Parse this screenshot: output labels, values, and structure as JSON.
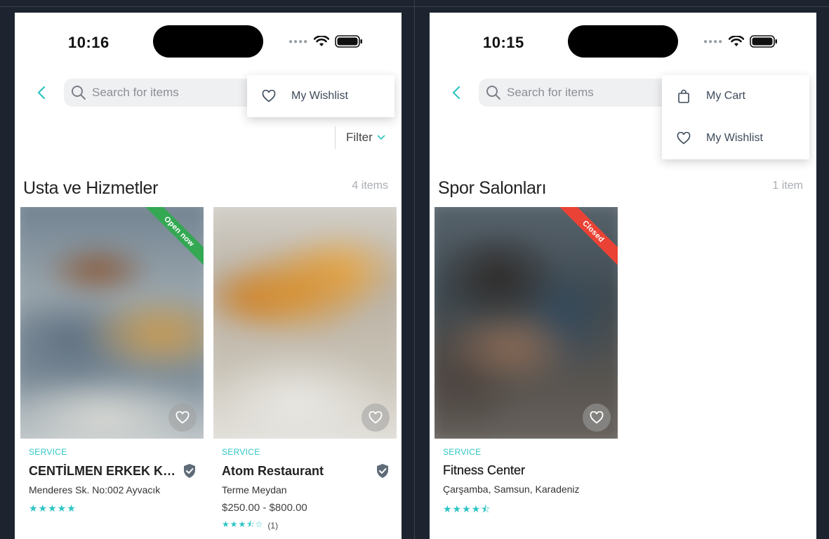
{
  "left_screen": {
    "status_time": "10:16",
    "search_placeholder": "Search for items",
    "filter_label": "Filter",
    "menu_items": [
      {
        "label": "My Wishlist",
        "icon": "heart-icon"
      }
    ],
    "section_title": "Usta ve Hizmetler",
    "section_count": "4 items",
    "cards": [
      {
        "category": "SERVICE",
        "title": "CENTİLMEN ERKEK KUAF...",
        "address": "Menderes Sk. No:002 Ayvacık",
        "price": "",
        "stars": "★★★★★",
        "rating_count": "",
        "ribbon": "Open now",
        "ribbon_color": "#34a853",
        "verified": true
      },
      {
        "category": "SERVICE",
        "title": "Atom Restaurant",
        "address": "Terme Meydan",
        "price": "$250.00 - $800.00",
        "stars": "★★★⯪☆",
        "rating_count": "(1)",
        "ribbon": "",
        "verified": true
      }
    ]
  },
  "right_screen": {
    "status_time": "10:15",
    "search_placeholder": "Search for items",
    "menu_items": [
      {
        "label": "My Cart",
        "icon": "shopping-bag-icon"
      },
      {
        "label": "My Wishlist",
        "icon": "heart-icon"
      }
    ],
    "section_title": "Spor Salonları",
    "section_count": "1 item",
    "cards": [
      {
        "category": "SERVICE",
        "title": "Fitness Center",
        "address": "Çarşamba, Samsun, Karadeniz",
        "stars": "★★★★⯪",
        "ribbon": "Closed",
        "ribbon_color": "#ea4335",
        "verified": false
      }
    ]
  },
  "colors": {
    "accent": "#2ec4c4",
    "background": "#1d2430",
    "open_ribbon": "#34a853",
    "closed_ribbon": "#ea4335"
  }
}
